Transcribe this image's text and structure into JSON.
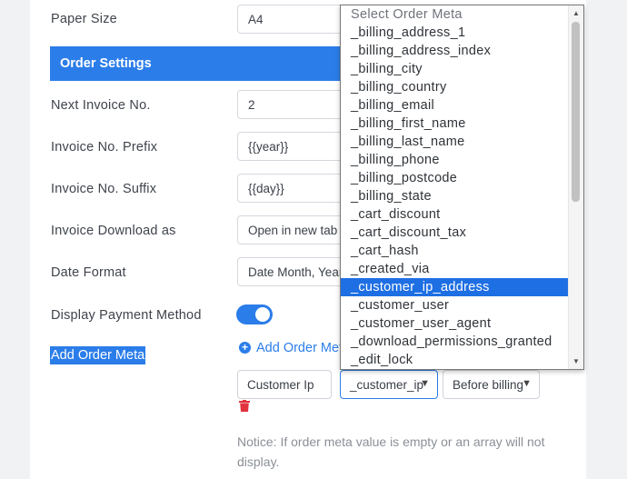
{
  "settings": {
    "paper_size": {
      "label": "Paper Size",
      "value": "A4"
    },
    "section_title": "Order Settings",
    "next_invoice": {
      "label": "Next Invoice No.",
      "value": "2"
    },
    "prefix": {
      "label": "Invoice No. Prefix",
      "value": "{{year}}"
    },
    "suffix": {
      "label": "Invoice No. Suffix",
      "value": "{{day}}"
    },
    "download_as": {
      "label": "Invoice Download as",
      "value": "Open in new tab"
    },
    "date_format": {
      "label": "Date Format",
      "value": "Date Month, Year"
    },
    "payment_method": {
      "label": "Display Payment Method",
      "enabled": true
    },
    "order_meta": {
      "label": "Add Order Meta",
      "add_link": "Add Order Meta",
      "name_value": "Customer Ip",
      "meta_value": "_customer_ip",
      "position_value": "Before billing",
      "notice": "Notice: If order meta value is empty or an array will not display."
    }
  },
  "dropdown": {
    "placeholder": "Select Order Meta",
    "options": [
      "_billing_address_1",
      "_billing_address_index",
      "_billing_city",
      "_billing_country",
      "_billing_email",
      "_billing_first_name",
      "_billing_last_name",
      "_billing_phone",
      "_billing_postcode",
      "_billing_state",
      "_cart_discount",
      "_cart_discount_tax",
      "_cart_hash",
      "_created_via",
      "_customer_ip_address",
      "_customer_user",
      "_customer_user_agent",
      "_download_permissions_granted",
      "_edit_lock"
    ],
    "selected": "_customer_ip_address"
  },
  "colors": {
    "accent": "#2b7de9",
    "highlight": "#1e6fe3"
  },
  "icons": {
    "add": "plus-circle-icon",
    "delete": "trash-icon",
    "chevron": "chevron-down-icon"
  }
}
